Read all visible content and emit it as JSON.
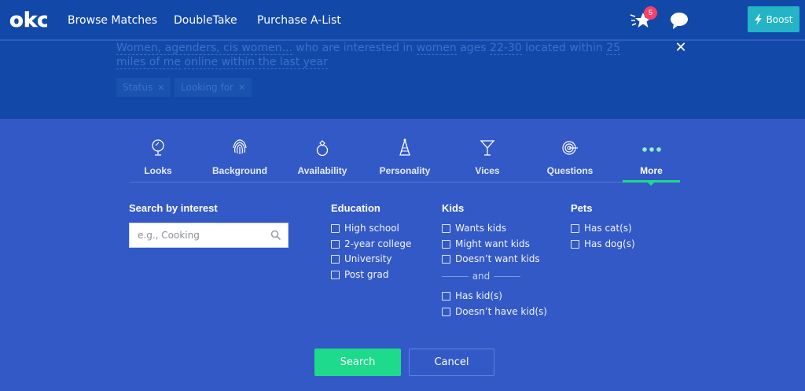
{
  "nav": {
    "logo": "okc",
    "links": [
      "Browse Matches",
      "DoubleTake",
      "Purchase A-List"
    ],
    "notification_count": "5",
    "boost_label": "Boost",
    "icons": [
      "star-icon",
      "chat-bubble-icon",
      "lightning-icon"
    ]
  },
  "summary": {
    "text_parts": [
      "Women, agenders, cis women...",
      " who are interested in ",
      "women",
      " ages ",
      "22-30",
      " located within ",
      "25 miles of me",
      " ",
      "online within the last year"
    ],
    "chips": [
      "Status",
      "Looking for"
    ]
  },
  "tabs": [
    {
      "label": "Looks",
      "icon": "mirror-icon"
    },
    {
      "label": "Background",
      "icon": "fingerprint-icon"
    },
    {
      "label": "Availability",
      "icon": "ring-icon"
    },
    {
      "label": "Personality",
      "icon": "party-hat-icon"
    },
    {
      "label": "Vices",
      "icon": "cocktail-icon"
    },
    {
      "label": "Questions",
      "icon": "target-icon"
    },
    {
      "label": "More",
      "icon": "dots-icon"
    }
  ],
  "active_tab": "More",
  "interest": {
    "title": "Search by interest",
    "placeholder": "e.g., Cooking"
  },
  "education": {
    "title": "Education",
    "options": [
      "High school",
      "2-year college",
      "University",
      "Post grad"
    ]
  },
  "kids": {
    "title": "Kids",
    "options_a": [
      "Wants kids",
      "Might want kids",
      "Doesn’t want kids"
    ],
    "and_label": "and",
    "options_b": [
      "Has kid(s)",
      "Doesn’t have kid(s)"
    ]
  },
  "pets": {
    "title": "Pets",
    "options": [
      "Has cat(s)",
      "Has dog(s)"
    ]
  },
  "actions": {
    "search": "Search",
    "cancel": "Cancel"
  },
  "colors": {
    "nav_bg": "#1249a8",
    "panel_bg": "#3359c7",
    "accent_green": "#1ddb8a",
    "boost": "#23b5c6",
    "badge": "#f2426b"
  }
}
